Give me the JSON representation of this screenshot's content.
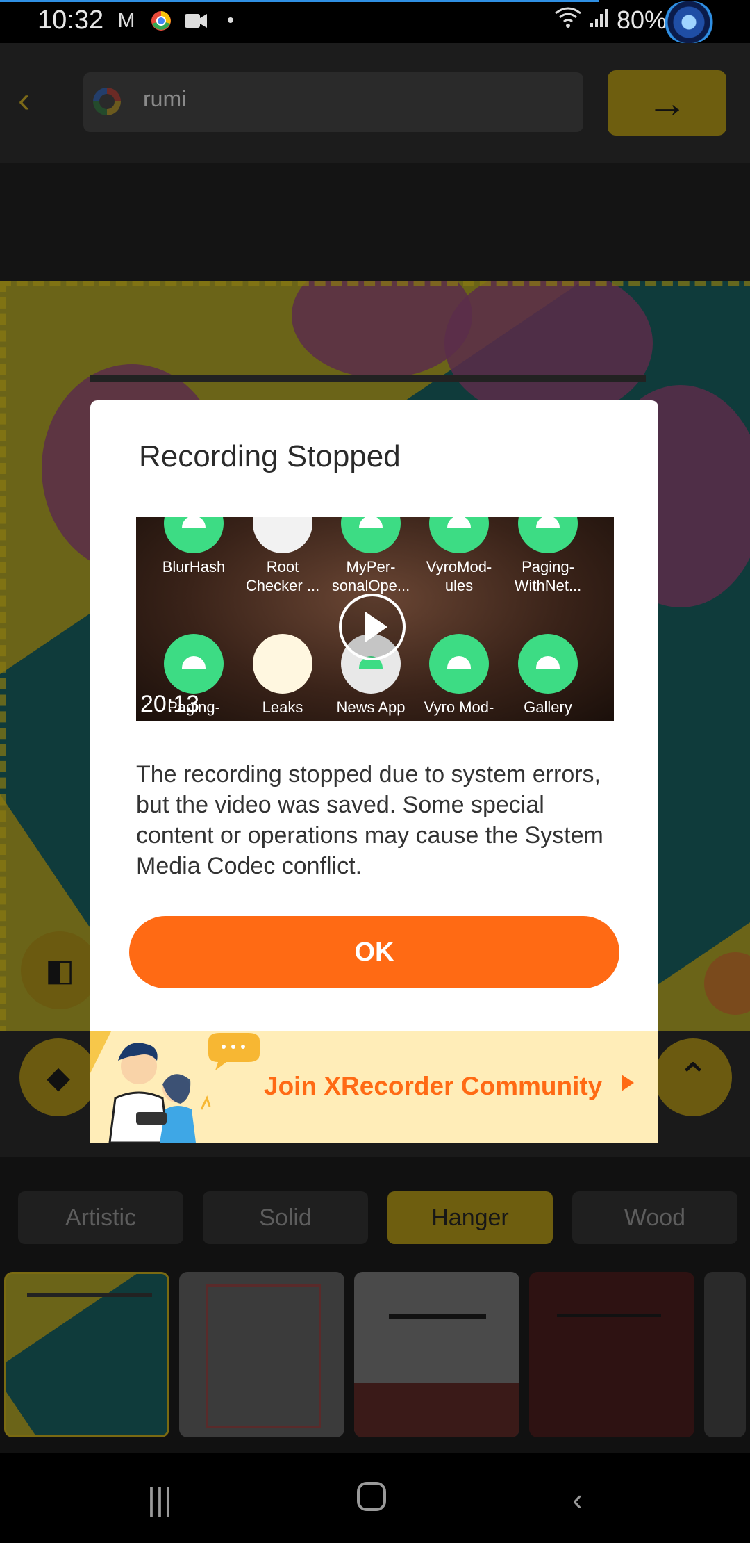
{
  "status_bar": {
    "time": "10:32",
    "battery": "80%",
    "icons": [
      "gmail-icon",
      "chrome-icon",
      "video-call-icon",
      "dot-icon",
      "wifi-icon",
      "signal-icon",
      "battery-charging-icon",
      "screen-recorder-icon"
    ]
  },
  "search": {
    "query": "rumi",
    "back_icon": "back-arrow-icon",
    "go_icon": "arrow-right-icon"
  },
  "frame_tabs": [
    {
      "label": "Artistic",
      "active": false
    },
    {
      "label": "Solid",
      "active": false
    },
    {
      "label": "Hanger",
      "active": true
    },
    {
      "label": "Wood",
      "active": false
    }
  ],
  "dialog": {
    "title": "Recording Stopped",
    "preview": {
      "duration": "20:13",
      "apps_row1": [
        "BlurHash",
        "Root Checker ...",
        "MyPer-sonalOpe...",
        "VyroMod-ules",
        "Paging-WithNet..."
      ],
      "apps_row2": [
        "Paging-",
        "Leaks",
        "News App",
        "Vyro Mod-",
        "Gallery"
      ]
    },
    "message": "The recording stopped due to system errors, but the video was saved. Some special content or operations may cause the System Media Codec conflict.",
    "ok_label": "OK",
    "community_label": "Join XRecorder Community"
  },
  "colors": {
    "accent_orange": "#ff6a14",
    "community_bg": "#ffedb8",
    "app_accent_dim": "#6e5e0f"
  }
}
